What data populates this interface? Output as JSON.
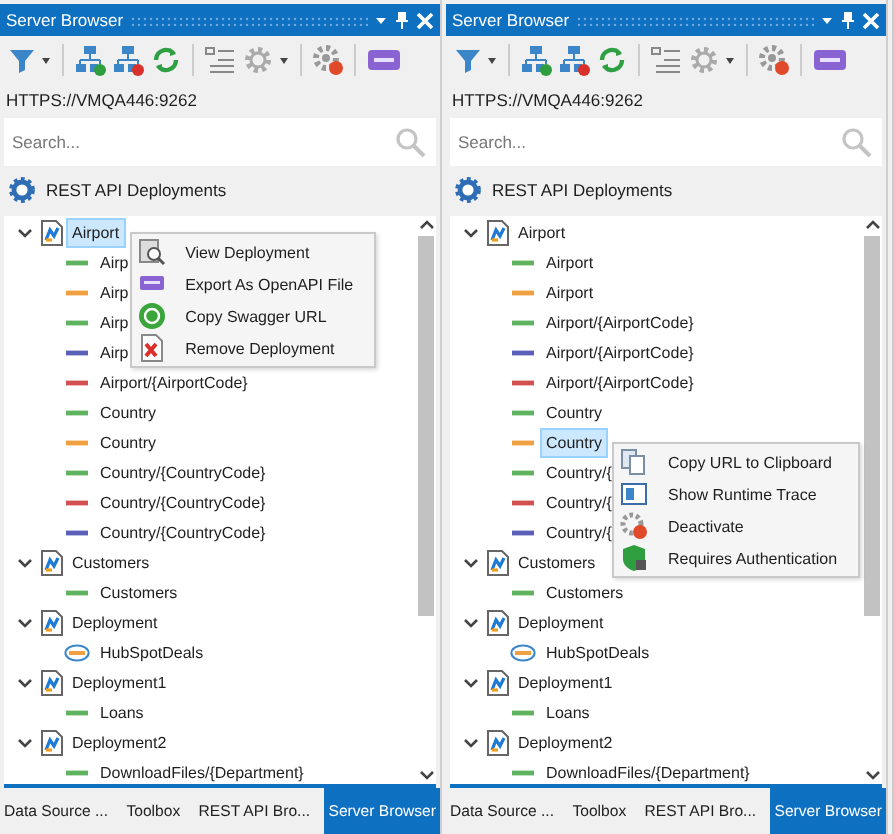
{
  "panels": [
    {
      "title": "Server Browser",
      "url": "HTTPS://VMQA446:9262",
      "search": {
        "placeholder": "Search..."
      },
      "section": "REST API Deployments",
      "tree": [
        {
          "label": "Airport",
          "expanded": true,
          "selected": true,
          "context_menu": [
            {
              "label": "View Deployment"
            },
            {
              "label": "Export As OpenAPI File"
            },
            {
              "label": "Copy Swagger URL"
            },
            {
              "label": "Remove Deployment"
            }
          ],
          "children": [
            {
              "label": "Airp",
              "kind": "get",
              "selected": false
            },
            {
              "label": "Airp",
              "kind": "post",
              "selected": false
            },
            {
              "label": "Airp",
              "kind": "get",
              "selected": false
            },
            {
              "label": "Airp",
              "kind": "put",
              "selected": false
            },
            {
              "label": "Airport/{AirportCode}",
              "kind": "del",
              "selected": false
            },
            {
              "label": "Country",
              "kind": "get",
              "selected": false
            },
            {
              "label": "Country",
              "kind": "post",
              "selected": false
            },
            {
              "label": "Country/{CountryCode}",
              "kind": "get",
              "selected": false
            },
            {
              "label": "Country/{CountryCode}",
              "kind": "del",
              "selected": false
            },
            {
              "label": "Country/{CountryCode}",
              "kind": "put",
              "selected": false
            }
          ]
        },
        {
          "label": "Customers",
          "expanded": true,
          "selected": false,
          "children": [
            {
              "label": "Customers",
              "kind": "get",
              "selected": false
            }
          ]
        },
        {
          "label": "Deployment",
          "expanded": true,
          "selected": false,
          "children": [
            {
              "label": "HubSpotDeals",
              "kind": "rest",
              "selected": false
            }
          ]
        },
        {
          "label": "Deployment1",
          "expanded": true,
          "selected": false,
          "children": [
            {
              "label": "Loans",
              "kind": "get",
              "selected": false
            }
          ]
        },
        {
          "label": "Deployment2",
          "expanded": true,
          "selected": false,
          "children": [
            {
              "label": "DownloadFiles/{Department}",
              "kind": "get",
              "selected": false
            }
          ]
        }
      ],
      "tabs": [
        {
          "label": "Data Source ...",
          "selected": false
        },
        {
          "label": "Toolbox",
          "selected": false
        },
        {
          "label": "REST API Bro...",
          "selected": false
        },
        {
          "label": "Server Browser",
          "selected": true
        }
      ]
    },
    {
      "title": "Server Browser",
      "url": "HTTPS://VMQA446:9262",
      "search": {
        "placeholder": "Search..."
      },
      "section": "REST API Deployments",
      "tree": [
        {
          "label": "Airport",
          "expanded": true,
          "selected": false,
          "children": [
            {
              "label": "Airport",
              "kind": "get",
              "selected": false
            },
            {
              "label": "Airport",
              "kind": "post",
              "selected": false
            },
            {
              "label": "Airport/{AirportCode}",
              "kind": "get",
              "selected": false
            },
            {
              "label": "Airport/{AirportCode}",
              "kind": "put",
              "selected": false
            },
            {
              "label": "Airport/{AirportCode}",
              "kind": "del",
              "selected": false
            },
            {
              "label": "Country",
              "kind": "get",
              "selected": false
            },
            {
              "label": "Country",
              "kind": "post",
              "selected": true,
              "context_menu": [
                {
                  "label": "Copy URL to Clipboard"
                },
                {
                  "label": "Show Runtime Trace"
                },
                {
                  "label": "Deactivate"
                },
                {
                  "label": "Requires Authentication"
                }
              ]
            },
            {
              "label": "Country/{",
              "kind": "get",
              "selected": false
            },
            {
              "label": "Country/{",
              "kind": "del",
              "selected": false
            },
            {
              "label": "Country/{",
              "kind": "put",
              "selected": false
            }
          ]
        },
        {
          "label": "Customers",
          "expanded": true,
          "selected": false,
          "children": [
            {
              "label": "Customers",
              "kind": "get",
              "selected": false
            }
          ]
        },
        {
          "label": "Deployment",
          "expanded": true,
          "selected": false,
          "children": [
            {
              "label": "HubSpotDeals",
              "kind": "rest",
              "selected": false
            }
          ]
        },
        {
          "label": "Deployment1",
          "expanded": true,
          "selected": false,
          "children": [
            {
              "label": "Loans",
              "kind": "get",
              "selected": false
            }
          ]
        },
        {
          "label": "Deployment2",
          "expanded": true,
          "selected": false,
          "children": [
            {
              "label": "DownloadFiles/{Department}",
              "kind": "get",
              "selected": false
            }
          ]
        }
      ],
      "tabs": [
        {
          "label": "Data Source ...",
          "selected": false
        },
        {
          "label": "Toolbox",
          "selected": false
        },
        {
          "label": "REST API Bro...",
          "selected": false
        },
        {
          "label": "Server Browser",
          "selected": true
        }
      ]
    }
  ]
}
